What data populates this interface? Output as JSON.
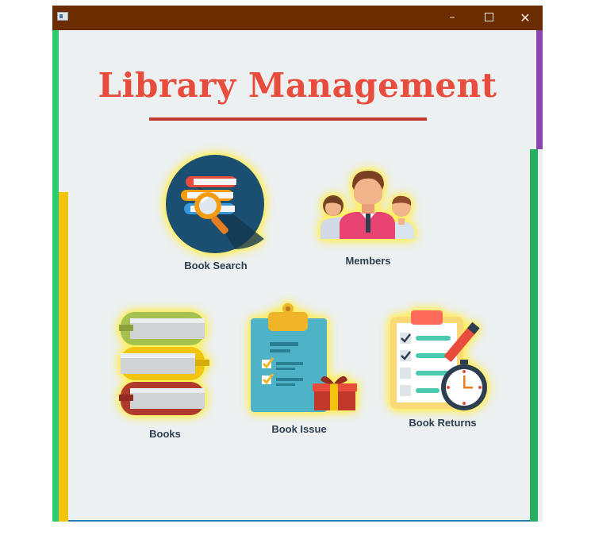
{
  "window": {
    "minimize_glyph": "–",
    "close_glyph": "✕"
  },
  "app": {
    "title": "Library Management"
  },
  "tiles": {
    "book_search": {
      "label": "Book Search",
      "icon": "magnifier-books-icon"
    },
    "members": {
      "label": "Members",
      "icon": "members-group-icon"
    },
    "books": {
      "label": "Books",
      "icon": "books-stack-icon"
    },
    "book_issue": {
      "label": "Book Issue",
      "icon": "clipboard-gift-icon"
    },
    "book_returns": {
      "label": "Book Returns",
      "icon": "checklist-clock-icon"
    }
  },
  "colors": {
    "titlebar": "#6b2d00",
    "background": "#ecf0f1",
    "title": "#e74c3c",
    "accent_green": "#2ecc71",
    "accent_yellow": "#f1c40f",
    "accent_purple": "#8e44ad"
  }
}
